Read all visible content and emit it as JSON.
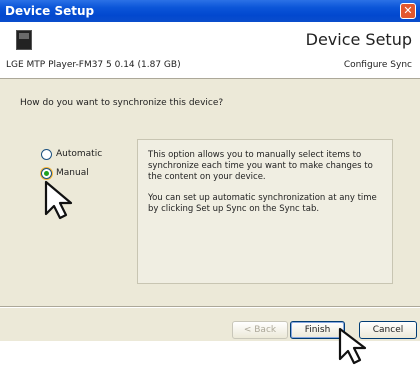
{
  "window": {
    "title": "Device Setup"
  },
  "header": {
    "title": "Device Setup",
    "device_name": "LGE MTP Player-FM37 5 0.14 (1.87 GB)",
    "subtitle": "Configure Sync"
  },
  "main": {
    "question": "How do you want to synchronize this device?",
    "options": [
      {
        "label": "Automatic",
        "selected": false
      },
      {
        "label": "Manual",
        "selected": true
      }
    ],
    "description": [
      "This option allows you to manually select items to synchronize each time you want to make changes to the content on your device.",
      "You can set up automatic synchronization at any time by clicking Set up Sync on the Sync tab."
    ]
  },
  "footer": {
    "back_label": "< Back",
    "finish_label": "Finish",
    "cancel_label": "Cancel"
  }
}
